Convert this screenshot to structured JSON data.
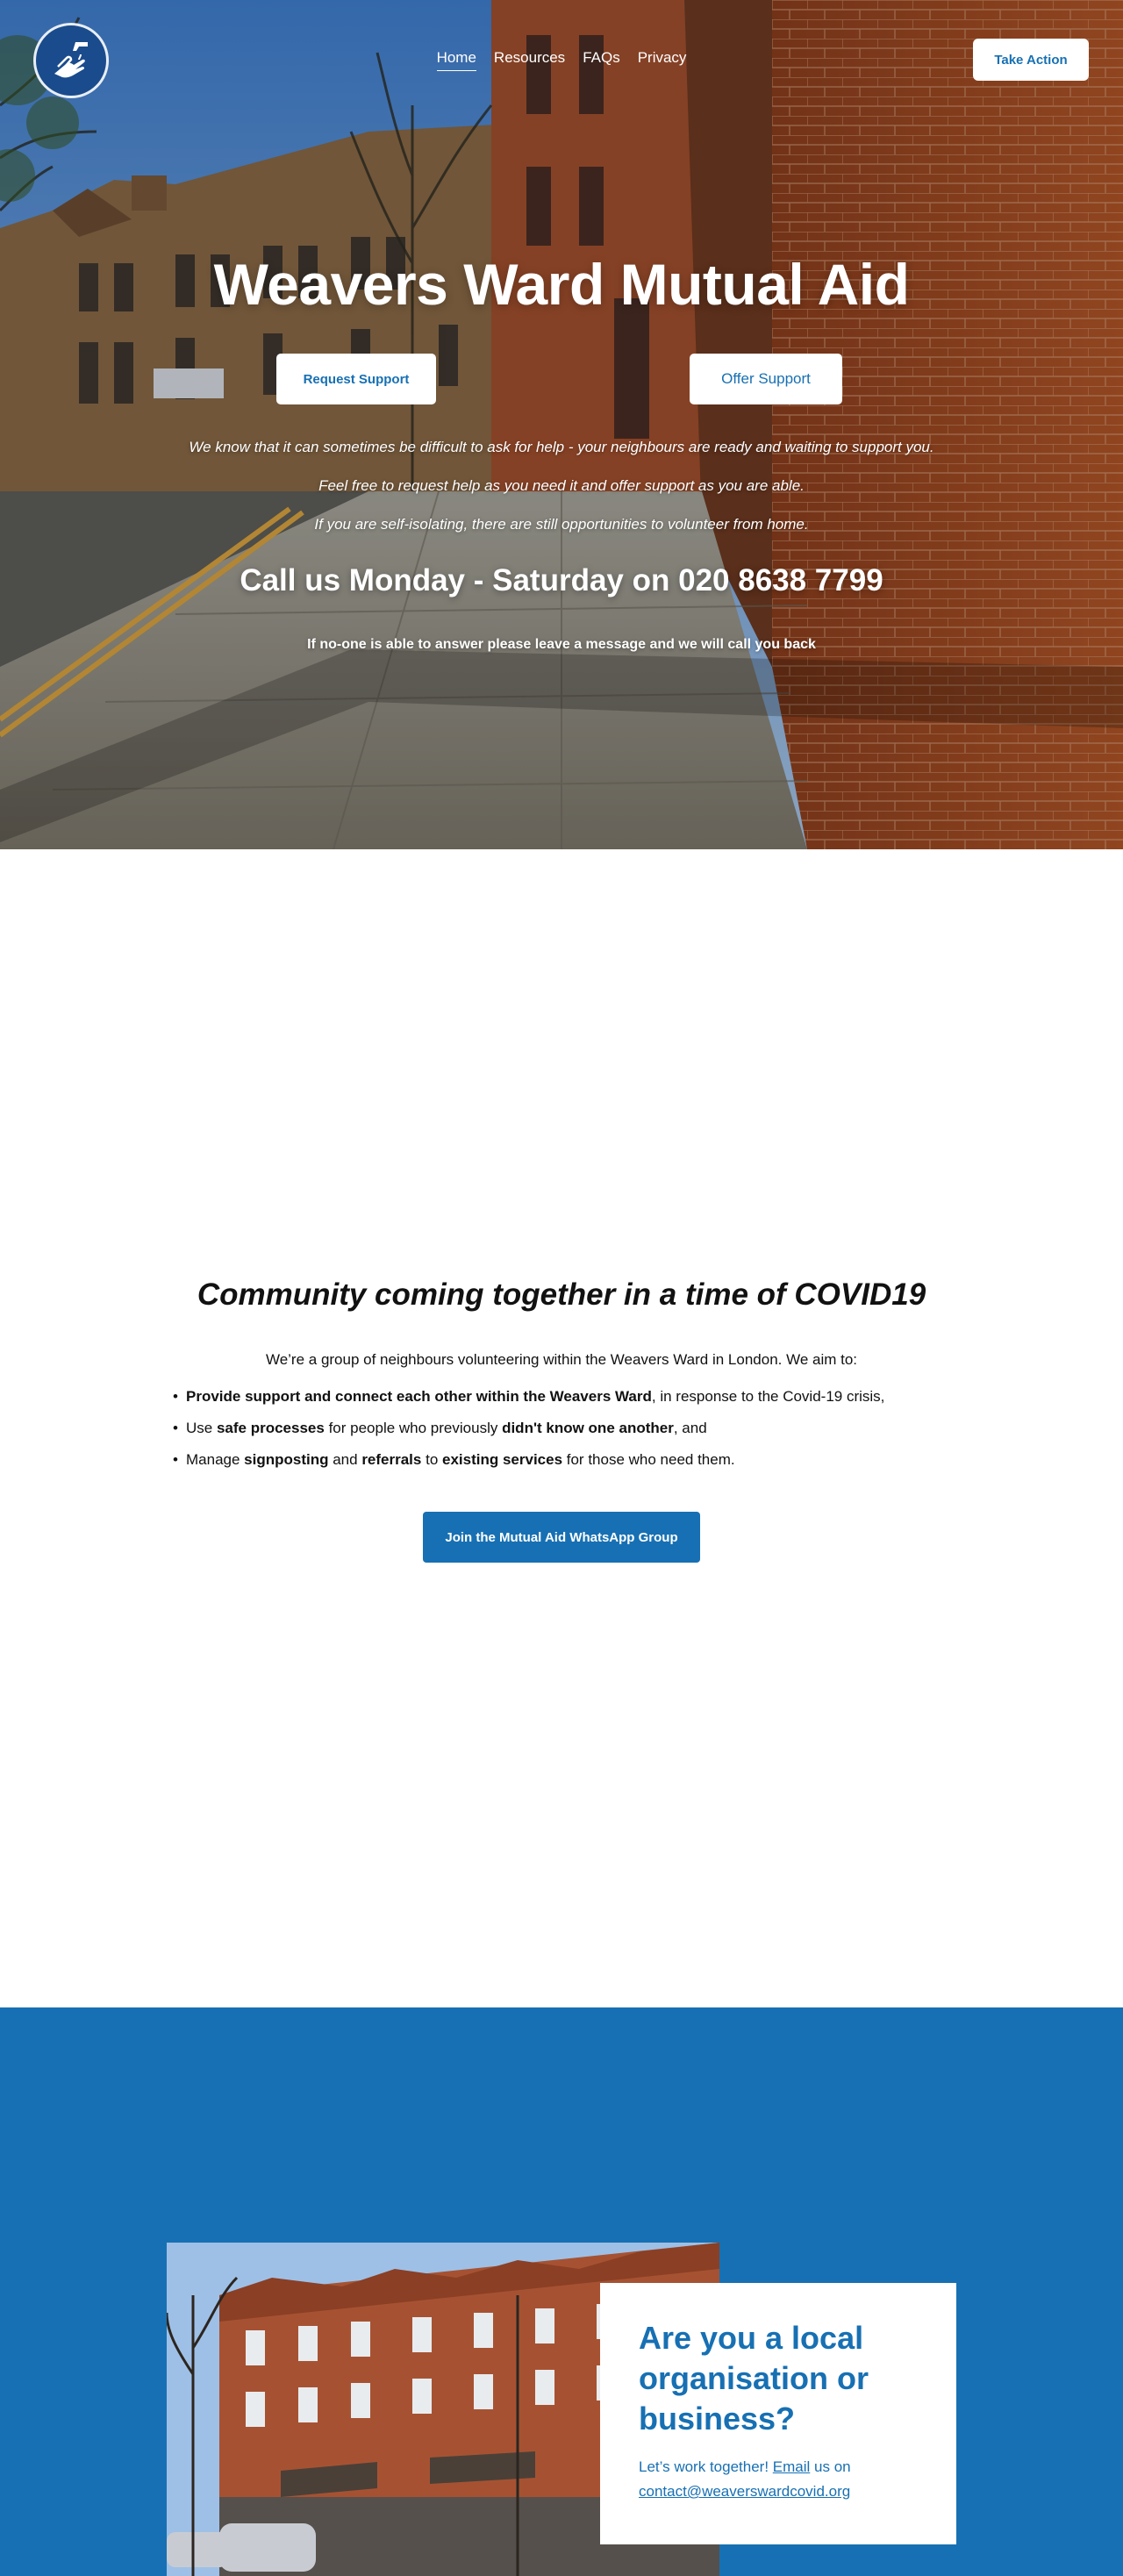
{
  "nav": {
    "items": [
      "Home",
      "Resources",
      "FAQs",
      "Privacy"
    ],
    "take_action": "Take Action"
  },
  "hero": {
    "title": "Weavers Ward Mutual Aid",
    "request_label": "Request Support",
    "offer_label": "Offer Support",
    "line1": "We know that it can sometimes be difficult to ask for help - your neighbours are ready and waiting to support you.",
    "line2": "Feel free to request help as you need it and offer support as you are able.",
    "line3": "If you are self-isolating, there are still opportunities to volunteer from home.",
    "phone": "Call us Monday - Saturday on 020 8638 7799",
    "note": "If no-one is able to answer please leave a message and we will call you back"
  },
  "community": {
    "title": "Community coming together in a time of COVID19",
    "intro": "We’re a group of neighbours volunteering within the Weavers Ward in London.  We aim to:",
    "aim1_bold": "Provide support and connect each other within the Weavers Ward",
    "aim1_rest": ", in response to the Covid-19 crisis,",
    "aim2_a": "Use ",
    "aim2_b": "safe processes",
    "aim2_c": " for people who previously ",
    "aim2_d": "didn't know one another",
    "aim2_e": ", and",
    "aim3_a": "Manage ",
    "aim3_b": "signposting",
    "aim3_c": " and ",
    "aim3_d": "referrals",
    "aim3_e": " to ",
    "aim3_f": "existing services",
    "aim3_g": " for those who need them.",
    "whatsapp_label": "Join the Mutual Aid WhatsApp Group"
  },
  "org": {
    "title": "Are you a local organisation or business?",
    "text_a": "Let’s work together! ",
    "email_link": "Email",
    "text_b": " us on ",
    "contact_link": "contact@weaverswardcovid.org"
  },
  "colors": {
    "accent": "#1770b3",
    "logo_bg": "#1a4b8c"
  },
  "icons": {
    "logo": "handwash-icon"
  }
}
